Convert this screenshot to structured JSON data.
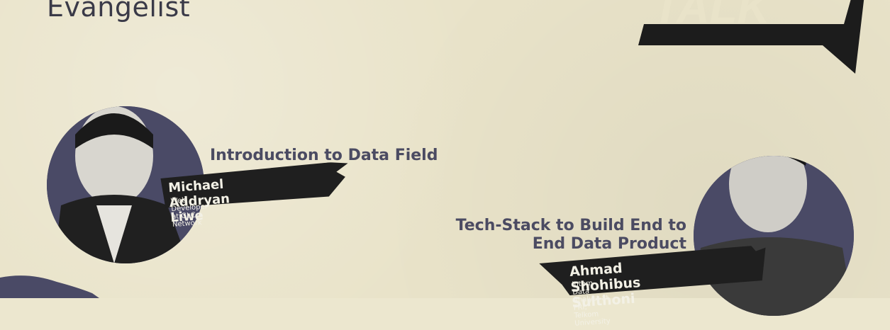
{
  "header": {
    "heading": "Evangelist"
  },
  "logo": {
    "text": "TALK"
  },
  "speakers": [
    {
      "topic": "Introduction to Data Field",
      "name": "Michael Addryan Liwe",
      "role": "Web Developer at GLC Network"
    },
    {
      "topic": "Tech-Stack to Build End to End Data Product",
      "name": "Ahmad Shohibus Sulthoni",
      "role": "Intern Data Analyst at FRI, Telkom University"
    }
  ],
  "colors": {
    "background": "#e9e3c9",
    "circle": "#4a4a66",
    "text": "#4b4b62",
    "tag": "#1f1f1f"
  }
}
